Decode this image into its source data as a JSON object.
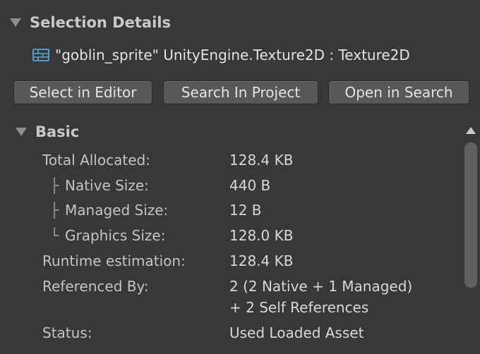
{
  "header": {
    "title": "Selection Details"
  },
  "asset": {
    "icon": "texture-icon",
    "text": "\"goblin_sprite\" UnityEngine.Texture2D : Texture2D"
  },
  "buttons": {
    "select_in_editor": "Select in Editor",
    "search_in_project": "Search In Project",
    "open_in_search": "Open in Search"
  },
  "basic": {
    "title": "Basic",
    "total_allocated_label": "Total Allocated:",
    "total_allocated_value": "128.4 KB",
    "native_size_label": "Native Size:",
    "native_size_value": "440 B",
    "managed_size_label": "Managed Size:",
    "managed_size_value": "12 B",
    "graphics_size_label": "Graphics Size:",
    "graphics_size_value": "128.0 KB",
    "runtime_estimation_label": "Runtime estimation:",
    "runtime_estimation_value": "128.4 KB",
    "referenced_by_label": "Referenced By:",
    "referenced_by_value_1": "2 (2 Native + 1 Managed)",
    "referenced_by_value_2": "+ 2 Self References",
    "status_label": "Status:",
    "status_value": "Used Loaded Asset"
  },
  "tree_glyphs": {
    "branch": "├",
    "last": "└"
  },
  "colors": {
    "background": "#383838",
    "button": "#585858",
    "icon_accent": "#5aa7d8"
  }
}
